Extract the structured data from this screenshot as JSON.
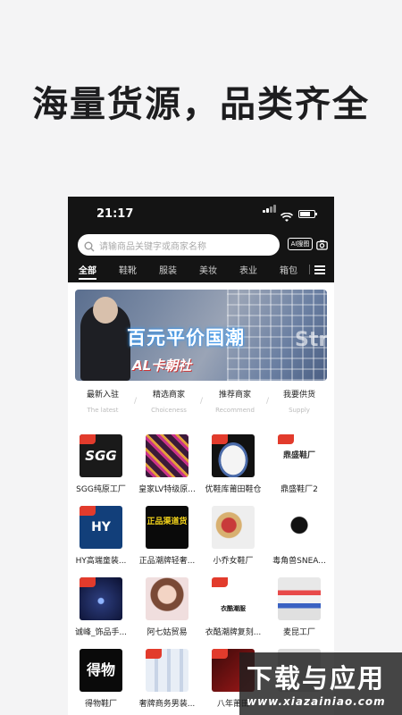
{
  "headline": "海量货源，品类齐全",
  "status": {
    "time": "21:17"
  },
  "search": {
    "placeholder": "请输商品关键字或商家名称",
    "ai_label": "AI搜图"
  },
  "tabs": [
    "全部",
    "鞋靴",
    "服装",
    "美妆",
    "表业",
    "箱包"
  ],
  "banner": {
    "title": "百元平价国潮",
    "subtitle": "AL卡朝社",
    "corner": "Str"
  },
  "quick": [
    {
      "title": "最新入驻",
      "sub": "The latest"
    },
    {
      "title": "精选商家",
      "sub": "Choiceness"
    },
    {
      "title": "推荐商家",
      "sub": "Recommend"
    },
    {
      "title": "我要供货",
      "sub": "Supply"
    }
  ],
  "stores": [
    {
      "name": "SGG纯原工厂",
      "logo": "SGG"
    },
    {
      "name": "皇家LV特级原...",
      "logo": ""
    },
    {
      "name": "优鞋库莆田鞋仓",
      "logo": ""
    },
    {
      "name": "鼎盛鞋厂2",
      "logo": "鼎盛鞋厂"
    },
    {
      "name": "HY高端童装...",
      "logo": "HY"
    },
    {
      "name": "正品潮牌轻奢...",
      "logo": "正品渠道货"
    },
    {
      "name": "小乔女鞋厂",
      "logo": ""
    },
    {
      "name": "毒角兽SNEA...",
      "logo": ""
    },
    {
      "name": "诚峰_饰品手...",
      "logo": ""
    },
    {
      "name": "阿七姑贸易",
      "logo": ""
    },
    {
      "name": "衣酷潮牌复刻...",
      "logo": "衣酷潮服"
    },
    {
      "name": "麦昆工厂",
      "logo": ""
    },
    {
      "name": "得物鞋厂",
      "logo": "得物"
    },
    {
      "name": "奢牌商务男装...",
      "logo": ""
    },
    {
      "name": "八年莆田",
      "logo": ""
    },
    {
      "name": "",
      "logo": ""
    }
  ],
  "watermark": {
    "title": "下载与应用",
    "url": "www.xiazainiao.com"
  },
  "colors": {
    "accent_red": "#e23b2c",
    "dark_header": "#141414"
  }
}
